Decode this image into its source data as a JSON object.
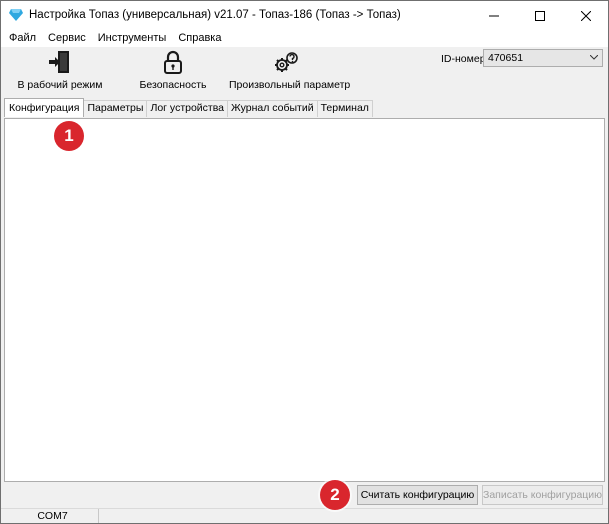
{
  "window": {
    "title": "Настройка Топаз (универсальная) v21.07 - Топаз-186 (Топаз -> Топаз)",
    "icon": "diamond-icon"
  },
  "menu": {
    "items": [
      "Файл",
      "Сервис",
      "Инструменты",
      "Справка"
    ]
  },
  "toolbar": {
    "work_mode_label": "В рабочий режим",
    "work_mode_icon": "exit-door-icon",
    "security_label": "Безопасность",
    "security_icon": "padlock-icon",
    "custom_param_label": "Произвольный параметр",
    "custom_param_icon": "gears-question-icon",
    "id_label": "ID-номер",
    "id_value": "470651"
  },
  "tabs": [
    {
      "label": "Конфигурация",
      "active": true
    },
    {
      "label": "Параметры",
      "active": false
    },
    {
      "label": "Лог устройства",
      "active": false
    },
    {
      "label": "Журнал событий",
      "active": false
    },
    {
      "label": "Терминал",
      "active": false
    }
  ],
  "buttons": {
    "read_config": "Считать конфигурацию",
    "write_config": "Записать конфигурацию"
  },
  "status": {
    "port": "COM7"
  },
  "markers": {
    "first": "1",
    "second": "2",
    "color": "#d9262d"
  }
}
